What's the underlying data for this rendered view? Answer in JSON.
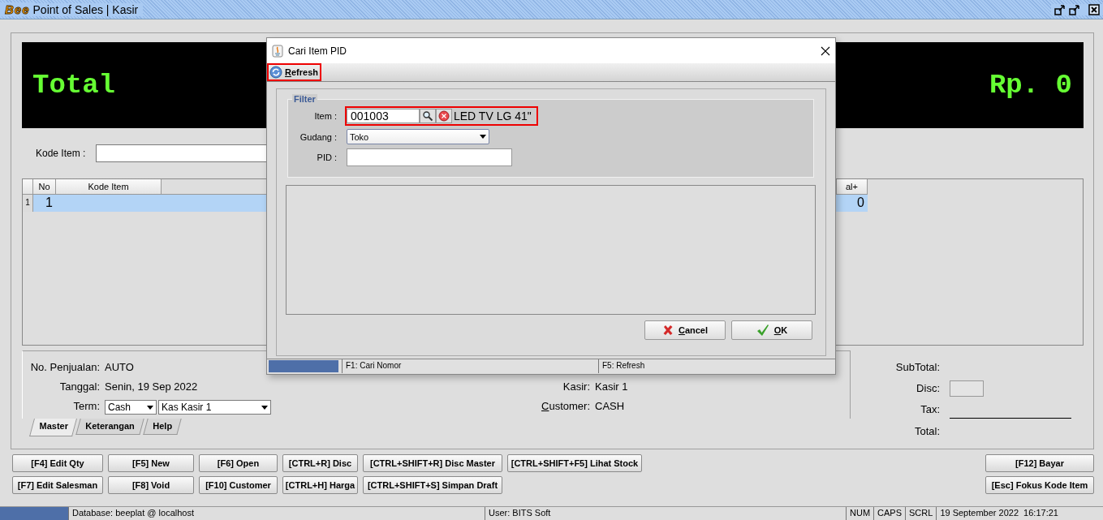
{
  "window": {
    "logo": "Bee",
    "title": "Point of Sales | Kasir"
  },
  "display": {
    "label": "Total",
    "amount": "Rp. 0"
  },
  "kode_item": {
    "label": "Kode Item :"
  },
  "table": {
    "columns": [
      {
        "label": "No"
      },
      {
        "label": "Kode Item"
      },
      {
        "kind": "blank"
      },
      {
        "label": "al+"
      }
    ],
    "rows": [
      {
        "number": "1",
        "no": "1",
        "value": "0",
        "selected": true
      }
    ]
  },
  "details": {
    "left": [
      {
        "kind": "text",
        "label": "No. Penjualan:",
        "value": "AUTO"
      },
      {
        "kind": "text",
        "label": "Tanggal:",
        "value": "Senin, 19 Sep 2022"
      },
      {
        "kind": "selects",
        "label": "Term:",
        "selects": [
          "Cash",
          "Kas Kasir 1"
        ]
      }
    ],
    "right": [
      {
        "label": "Kasir:",
        "value": "Kasir 1",
        "underline_first": false
      },
      {
        "label": "Customer:",
        "value": "CASH",
        "underline_first": true
      }
    ]
  },
  "tabs": [
    {
      "label": "Master",
      "selected": true
    },
    {
      "label": "Keterangan",
      "selected": false
    },
    {
      "label": "Help",
      "selected": false
    }
  ],
  "totals": [
    {
      "kind": "text",
      "label": "SubTotal:"
    },
    {
      "kind": "box",
      "label": "Disc:"
    },
    {
      "kind": "rule",
      "label": "Tax:"
    },
    {
      "kind": "text",
      "label": "Total:"
    }
  ],
  "buttons": {
    "left": [
      [
        "[F4] Edit Qty",
        "[F7] Edit Salesman"
      ],
      [
        "[F5] New",
        "[F8] Void"
      ],
      [
        "[F6] Open",
        "[F10] Customer"
      ],
      [
        "[CTRL+R] Disc",
        "[CTRL+H] Harga"
      ],
      [
        "[CTRL+SHIFT+R] Disc Master",
        "[CTRL+SHIFT+S] Simpan Draft"
      ],
      [
        "[CTRL+SHIFT+F5] Lihat Stock"
      ]
    ],
    "right": [
      "[F12] Bayar",
      "[Esc] Fokus Kode Item"
    ]
  },
  "status_progress": {
    "level": 1
  },
  "status_bar": [
    "Database: beeplat @ localhost",
    "User: BITS Soft",
    "NUM",
    "CAPS",
    "SCRL",
    "19 September 2022  16:17:21"
  ],
  "dialog": {
    "title": "Cari Item PID",
    "toolbar": [
      {
        "label": "Refresh",
        "underline_first": true,
        "highlighted": true
      }
    ],
    "filter": {
      "legend": "Filter",
      "item": {
        "label": "Item :",
        "value": "001003",
        "description": "LED TV LG 41\"",
        "highlighted": true
      },
      "gudang": {
        "label": "Gudang :",
        "value": "Toko"
      },
      "pid": {
        "label": "PID :"
      }
    },
    "buttons": [
      {
        "kind": "cancel",
        "label": "Cancel",
        "underline_first": true
      },
      {
        "kind": "ok",
        "label": "OK",
        "underline_first": true
      }
    ],
    "progress": {
      "level": 1
    },
    "status": [
      "F1: Cari Nomor",
      "F5: Refresh"
    ]
  }
}
